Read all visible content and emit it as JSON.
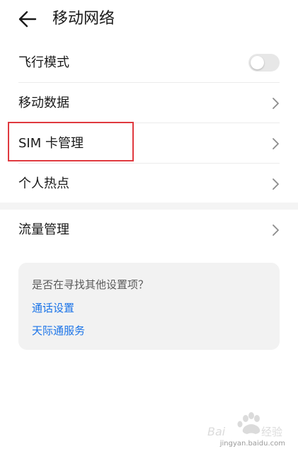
{
  "header": {
    "title": "移动网络",
    "back_icon": "arrow-left-icon"
  },
  "settings": {
    "airplane_mode": {
      "label": "飞行模式",
      "enabled": false
    },
    "mobile_data": {
      "label": "移动数据"
    },
    "sim_management": {
      "label": "SIM 卡管理",
      "highlighted": true,
      "highlight_color": "#e0393f"
    },
    "hotspot": {
      "label": "个人热点"
    },
    "data_usage": {
      "label": "流量管理"
    }
  },
  "suggestions": {
    "hint": "是否在寻找其他设置项？",
    "links": [
      "通话设置",
      "天际通服务"
    ],
    "link_color": "#1a73e8"
  },
  "watermark": {
    "brand": "Bai du 经验",
    "url": "jingyan.baidu.com"
  }
}
